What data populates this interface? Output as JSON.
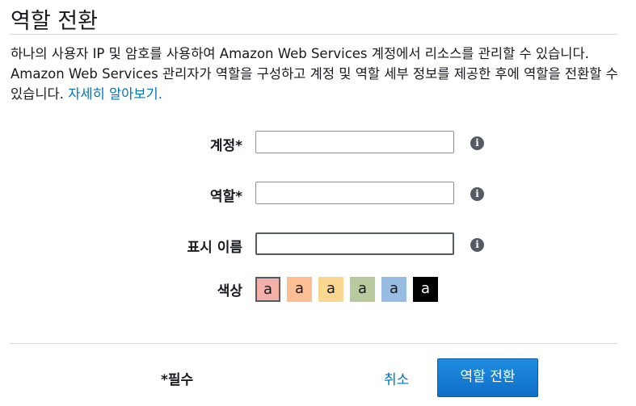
{
  "title": "역할 전환",
  "description": {
    "text": "하나의 사용자 IP 및 암호를 사용하여 Amazon Web Services 계정에서 리소스를 관리할 수 있습니다. Amazon Web Services 관리자가 역할을 구성하고 계정 및 역할 세부 정보를 제공한 후에 역할을 전환할 수 있습니다.",
    "link": "자세히 알아보기."
  },
  "form": {
    "account": {
      "label": "계정*",
      "value": ""
    },
    "role": {
      "label": "역할*",
      "value": ""
    },
    "display_name": {
      "label": "표시 이름",
      "value": ""
    },
    "color": {
      "label": "색상",
      "swatches": [
        {
          "text": "a",
          "color": "#f2b0a9",
          "selected": true
        },
        {
          "text": "a",
          "color": "#fbbf93",
          "selected": false
        },
        {
          "text": "a",
          "color": "#fad791",
          "selected": false
        },
        {
          "text": "a",
          "color": "#b7ca9d",
          "selected": false
        },
        {
          "text": "a",
          "color": "#99bce3",
          "selected": false
        },
        {
          "text": "a",
          "color": "#000000",
          "selected": false
        }
      ]
    },
    "info_icon": "i"
  },
  "footer": {
    "required": "*필수",
    "cancel": "취소",
    "submit": "역할 전환"
  }
}
